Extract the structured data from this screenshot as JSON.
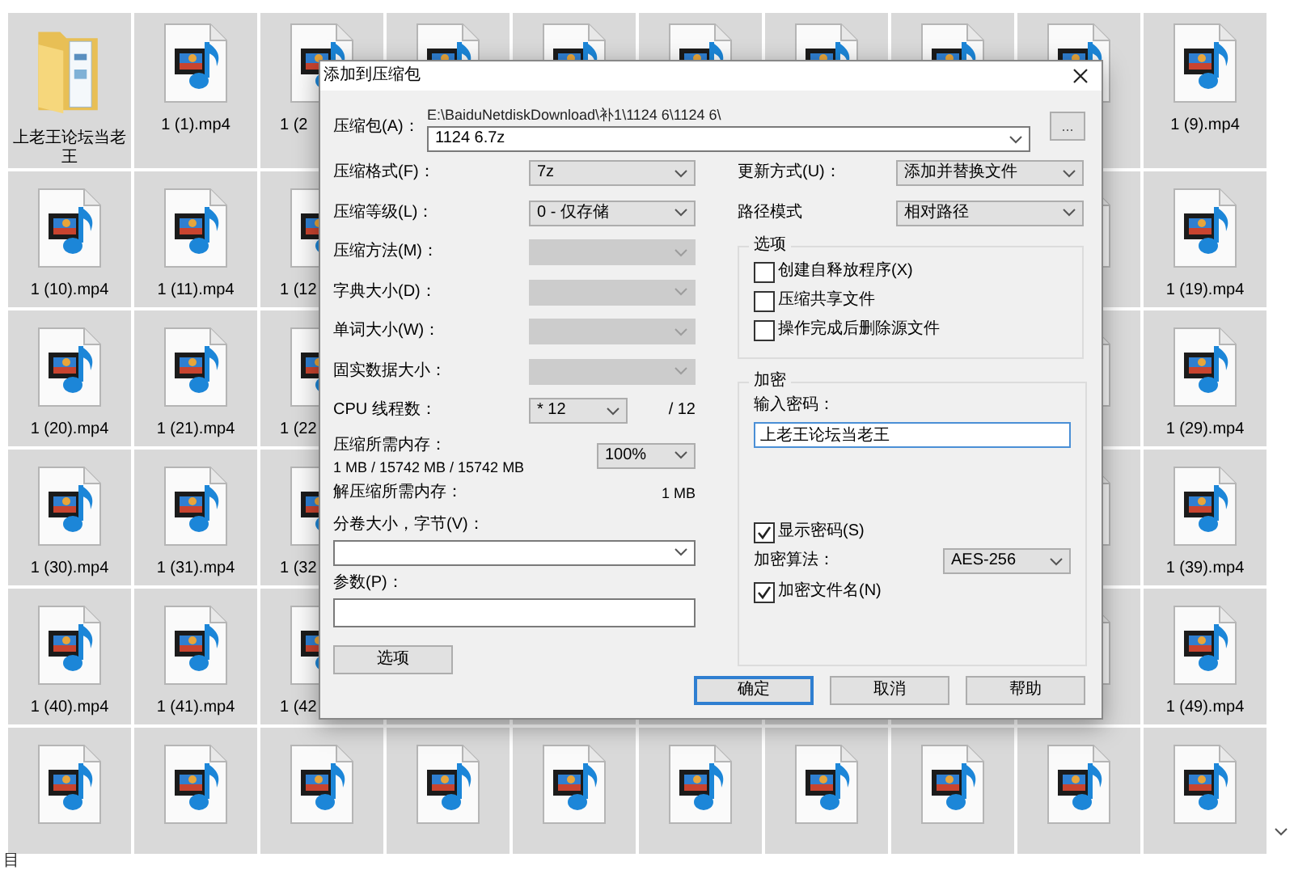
{
  "explorer": {
    "rows": [
      [
        {
          "kind": "folder",
          "selected": true,
          "label": "上老王论坛当老王"
        },
        {
          "kind": "video",
          "selected": true,
          "label": "1 (1).mp4"
        },
        {
          "kind": "video",
          "selected": true,
          "label": "1 (2"
        },
        {
          "kind": "video",
          "selected": true
        },
        {
          "kind": "video",
          "selected": true
        },
        {
          "kind": "video",
          "selected": true
        },
        {
          "kind": "video",
          "selected": true
        },
        {
          "kind": "video",
          "selected": true
        },
        {
          "kind": "video",
          "selected": true
        },
        {
          "kind": "video",
          "selected": true,
          "label": "1 (9).mp4"
        }
      ],
      [
        {
          "kind": "video",
          "selected": true,
          "label": "1 (10).mp4"
        },
        {
          "kind": "video",
          "selected": true,
          "label": "1 (11).mp4"
        },
        {
          "kind": "video",
          "selected": true,
          "label": "1 (12"
        },
        null,
        null,
        null,
        null,
        null,
        {
          "kind": "video",
          "selected": true
        },
        {
          "kind": "video",
          "selected": true,
          "label": "1 (19).mp4"
        }
      ],
      [
        {
          "kind": "video",
          "selected": true,
          "label": "1 (20).mp4"
        },
        {
          "kind": "video",
          "selected": true,
          "label": "1 (21).mp4"
        },
        {
          "kind": "video",
          "selected": true,
          "label": "1 (22"
        },
        null,
        null,
        null,
        null,
        null,
        {
          "kind": "video",
          "selected": true
        },
        {
          "kind": "video",
          "selected": true,
          "label": "1 (29).mp4"
        }
      ],
      [
        {
          "kind": "video",
          "selected": true,
          "label": "1 (30).mp4"
        },
        {
          "kind": "video",
          "selected": true,
          "label": "1 (31).mp4"
        },
        {
          "kind": "video",
          "selected": true,
          "label": "1 (32"
        },
        null,
        null,
        null,
        null,
        null,
        {
          "kind": "video",
          "selected": true
        },
        {
          "kind": "video",
          "selected": true,
          "label": "1 (39).mp4"
        }
      ],
      [
        {
          "kind": "video",
          "selected": true,
          "label": "1 (40).mp4"
        },
        {
          "kind": "video",
          "selected": true,
          "label": "1 (41).mp4"
        },
        {
          "kind": "video",
          "selected": true,
          "label": "1 (42"
        },
        null,
        null,
        null,
        null,
        null,
        {
          "kind": "video",
          "selected": true
        },
        {
          "kind": "video",
          "selected": true,
          "label": "1 (49).mp4"
        }
      ],
      [
        {
          "kind": "video",
          "selected": true
        },
        {
          "kind": "video",
          "selected": true
        },
        {
          "kind": "video",
          "selected": true
        },
        {
          "kind": "video",
          "selected": true
        },
        {
          "kind": "video",
          "selected": true
        },
        {
          "kind": "video",
          "selected": true
        },
        {
          "kind": "video",
          "selected": true
        },
        {
          "kind": "video",
          "selected": true
        },
        {
          "kind": "video",
          "selected": true
        },
        {
          "kind": "video",
          "selected": true
        }
      ]
    ],
    "status_text": "目"
  },
  "dialog": {
    "title": "添加到压缩包",
    "archive": {
      "label": "压缩包(A)：",
      "path": "E:\\BaiduNetdiskDownload\\补1\\1124 6\\1124 6\\",
      "value": "1124 6.7z"
    },
    "browse_button": "...",
    "left": [
      {
        "kind": "combo",
        "label": "压缩格式(F)：",
        "value": "7z",
        "disabled": false
      },
      {
        "kind": "combo",
        "label": "压缩等级(L)：",
        "value": "0 - 仅存储",
        "disabled": false
      },
      {
        "kind": "combo",
        "label": "压缩方法(M)：",
        "disabled": true
      },
      {
        "kind": "combo",
        "label": "字典大小(D)：",
        "disabled": true
      },
      {
        "kind": "combo",
        "label": "单词大小(W)：",
        "disabled": true
      },
      {
        "kind": "combo",
        "label": "固实数据大小：",
        "disabled": true
      },
      {
        "kind": "threads",
        "label": "CPU 线程数：",
        "value": "* 12",
        "suffix": "/ 12"
      },
      {
        "kind": "memory",
        "label": "压缩所需内存：",
        "detail": "1 MB / 15742 MB / 15742 MB",
        "value": "100%"
      },
      {
        "kind": "info",
        "label": "解压缩所需内存：",
        "value": "1 MB"
      },
      {
        "kind": "wide_combo",
        "label": "分卷大小，字节(V)："
      },
      {
        "kind": "text",
        "label": "参数(P)："
      }
    ],
    "options_button": "选项",
    "right": [
      {
        "label": "更新方式(U)：",
        "value": "添加并替换文件"
      },
      {
        "label": "路径模式",
        "value": "相对路径"
      }
    ],
    "options_group": {
      "title": "选项",
      "checkboxes": [
        {
          "label": "创建自释放程序(X)",
          "checked": false
        },
        {
          "label": "压缩共享文件",
          "checked": false
        },
        {
          "label": "操作完成后删除源文件",
          "checked": false
        }
      ]
    },
    "encryption": {
      "title": "加密",
      "password_label": "输入密码：",
      "password": "上老王论坛当老王",
      "show_password": {
        "label": "显示密码(S)",
        "checked": true
      },
      "method_label": "加密算法：",
      "method": "AES-256",
      "encrypt_names": {
        "label": "加密文件名(N)",
        "checked": true
      }
    },
    "buttons": [
      {
        "label": "确定",
        "default": true
      },
      {
        "label": "取消",
        "default": false
      },
      {
        "label": "帮助",
        "default": false
      }
    ]
  }
}
